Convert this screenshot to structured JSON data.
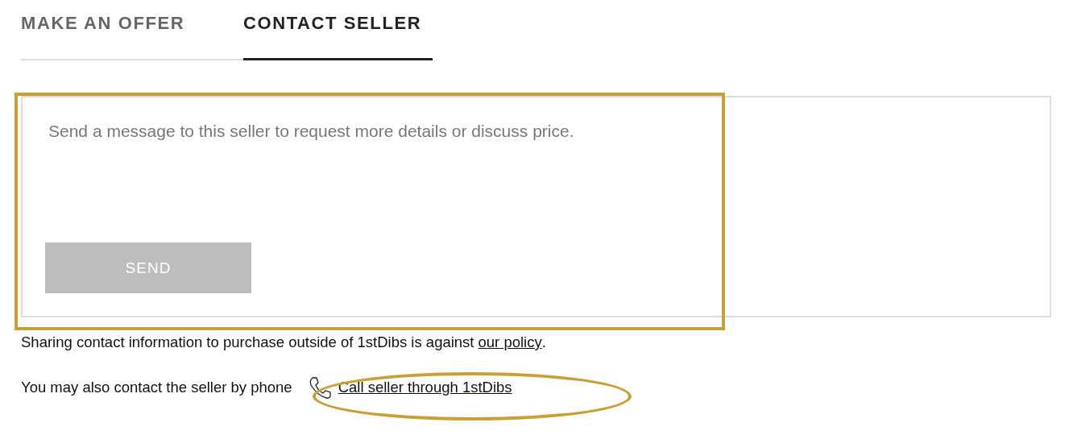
{
  "tabs": [
    {
      "label": "MAKE AN OFFER",
      "selected": false
    },
    {
      "label": "CONTACT SELLER",
      "selected": true
    }
  ],
  "message": {
    "placeholder": "Send a message to this seller to request more details or discuss price.",
    "send_button": {
      "label": "SEND",
      "disabled": true
    }
  },
  "policy_notice": {
    "text": "Sharing contact information to purchase outside of 1stDibs is against",
    "link": "our policy",
    "end": "."
  },
  "phone_contact": {
    "text": "You may also contact the seller by phone",
    "link": "Call seller through 1stDibs"
  },
  "annotations": [
    {
      "kind": "rectangle"
    },
    {
      "kind": "ellipse"
    }
  ]
}
